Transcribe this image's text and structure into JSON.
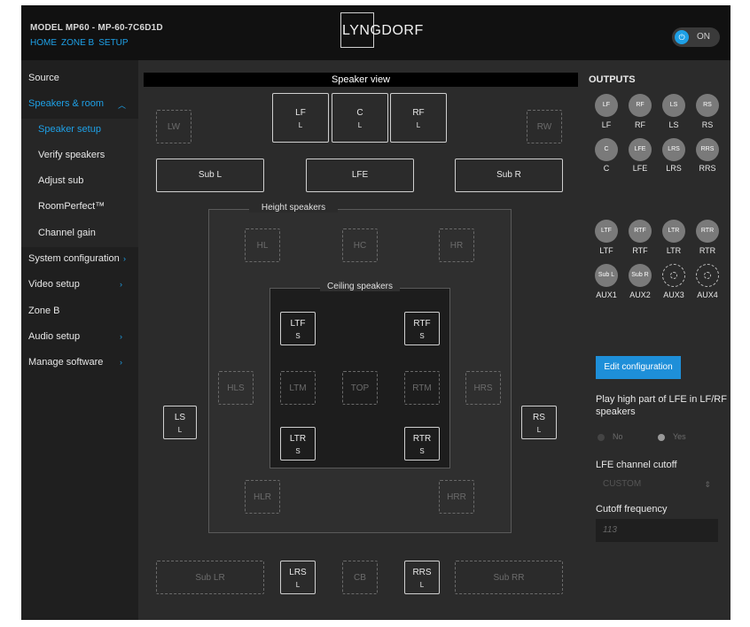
{
  "header": {
    "model": "MODEL MP60 - MP-60-7C6D1D",
    "nav": [
      "HOME",
      "ZONE B",
      "SETUP"
    ],
    "logo": "LYNGDORF",
    "power_label": "ON",
    "power_icon": "power-icon"
  },
  "sidebar": {
    "source": "Source",
    "speakers_room": "Speakers & room",
    "speaker_setup": "Speaker setup",
    "verify": "Verify speakers",
    "adjust_sub": "Adjust sub",
    "roomperfect": "RoomPerfect™",
    "channel_gain": "Channel gain",
    "system_config": "System configuration",
    "video": "Video setup",
    "zone_b": "Zone B",
    "audio": "Audio setup",
    "manage": "Manage software",
    "chevron": "›"
  },
  "view": {
    "title": "Speaker view",
    "height_title": "Height speakers",
    "ceiling_title": "Ceiling speakers"
  },
  "speakers": {
    "lw": "LW",
    "rw": "RW",
    "lf": "LF",
    "lf_size": "L",
    "c": "C",
    "c_size": "L",
    "rf": "RF",
    "rf_size": "L",
    "subl": "Sub L",
    "lfe": "LFE",
    "subr": "Sub R",
    "hl": "HL",
    "hc": "HC",
    "hr": "HR",
    "ltf": "LTF",
    "ltf_size": "S",
    "rtf": "RTF",
    "rtf_size": "S",
    "hls": "HLS",
    "ltm": "LTM",
    "top": "TOP",
    "rtm": "RTM",
    "hrs": "HRS",
    "ls": "LS",
    "ls_size": "L",
    "rs": "RS",
    "rs_size": "L",
    "ltr": "LTR",
    "ltr_size": "S",
    "rtr": "RTR",
    "rtr_size": "S",
    "hlr": "HLR",
    "hrr": "HRR",
    "sublr": "Sub LR",
    "lrs": "LRS",
    "lrs_size": "L",
    "cb": "CB",
    "rrs": "RRS",
    "rrs_size": "L",
    "subrr": "Sub RR"
  },
  "outputs": {
    "title": "OUTPUTS",
    "row1": [
      {
        "circle": "LF",
        "label": "LF"
      },
      {
        "circle": "RF",
        "label": "RF"
      },
      {
        "circle": "LS",
        "label": "LS"
      },
      {
        "circle": "RS",
        "label": "RS"
      }
    ],
    "row2": [
      {
        "circle": "C",
        "label": "C"
      },
      {
        "circle": "LFE",
        "label": "LFE"
      },
      {
        "circle": "LRS",
        "label": "LRS"
      },
      {
        "circle": "RRS",
        "label": "RRS"
      }
    ],
    "row3": [
      {
        "circle": "LTF",
        "label": "LTF"
      },
      {
        "circle": "RTF",
        "label": "RTF"
      },
      {
        "circle": "LTR",
        "label": "LTR"
      },
      {
        "circle": "RTR",
        "label": "RTR"
      }
    ],
    "row4": [
      {
        "circle": "Sub L",
        "label": "AUX1"
      },
      {
        "circle": "Sub R",
        "label": "AUX2"
      },
      {
        "circle": "",
        "label": "AUX3"
      },
      {
        "circle": "",
        "label": "AUX4"
      }
    ]
  },
  "settings": {
    "edit_button": "Edit configuration",
    "lfe_question": "Play high part of LFE in LF/RF speakers",
    "no": "No",
    "yes": "Yes",
    "cutoff_label": "LFE channel cutoff",
    "cutoff_value": "CUSTOM",
    "freq_label": "Cutoff frequency",
    "freq_value": "113"
  }
}
